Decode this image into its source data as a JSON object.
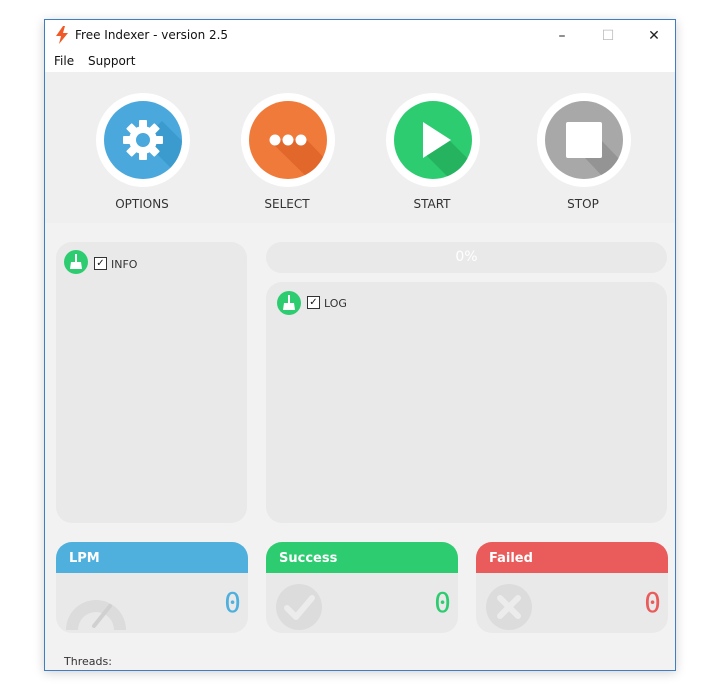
{
  "window": {
    "title": "Free Indexer - version 2.5"
  },
  "controls": {
    "minimize": "–",
    "maximize": "☐",
    "close": "✕"
  },
  "menu": {
    "items": [
      "File",
      "Support"
    ]
  },
  "toolbar": {
    "buttons": [
      {
        "label": "OPTIONS",
        "color": "#4aa8dc",
        "icon": "gear-icon"
      },
      {
        "label": "SELECT",
        "color": "#f07a3a",
        "icon": "ellipsis-icon"
      },
      {
        "label": "START",
        "color": "#2ecc71",
        "icon": "play-icon"
      },
      {
        "label": "STOP",
        "color": "#a8a8a8",
        "icon": "stop-icon"
      }
    ]
  },
  "info": {
    "label": "INFO",
    "checked": true
  },
  "progress": {
    "text": "0%",
    "value": 0
  },
  "log": {
    "label": "LOG",
    "checked": true
  },
  "stats": [
    {
      "label": "LPM",
      "value": "0",
      "color": "#4fb0de",
      "icon": "speedometer-icon"
    },
    {
      "label": "Success",
      "value": "0",
      "color": "#2ecc71",
      "icon": "checkmark-circle-icon"
    },
    {
      "label": "Failed",
      "value": "0",
      "color": "#ea5b5b",
      "icon": "x-circle-icon"
    }
  ],
  "status": {
    "threads_label": "Threads:"
  }
}
